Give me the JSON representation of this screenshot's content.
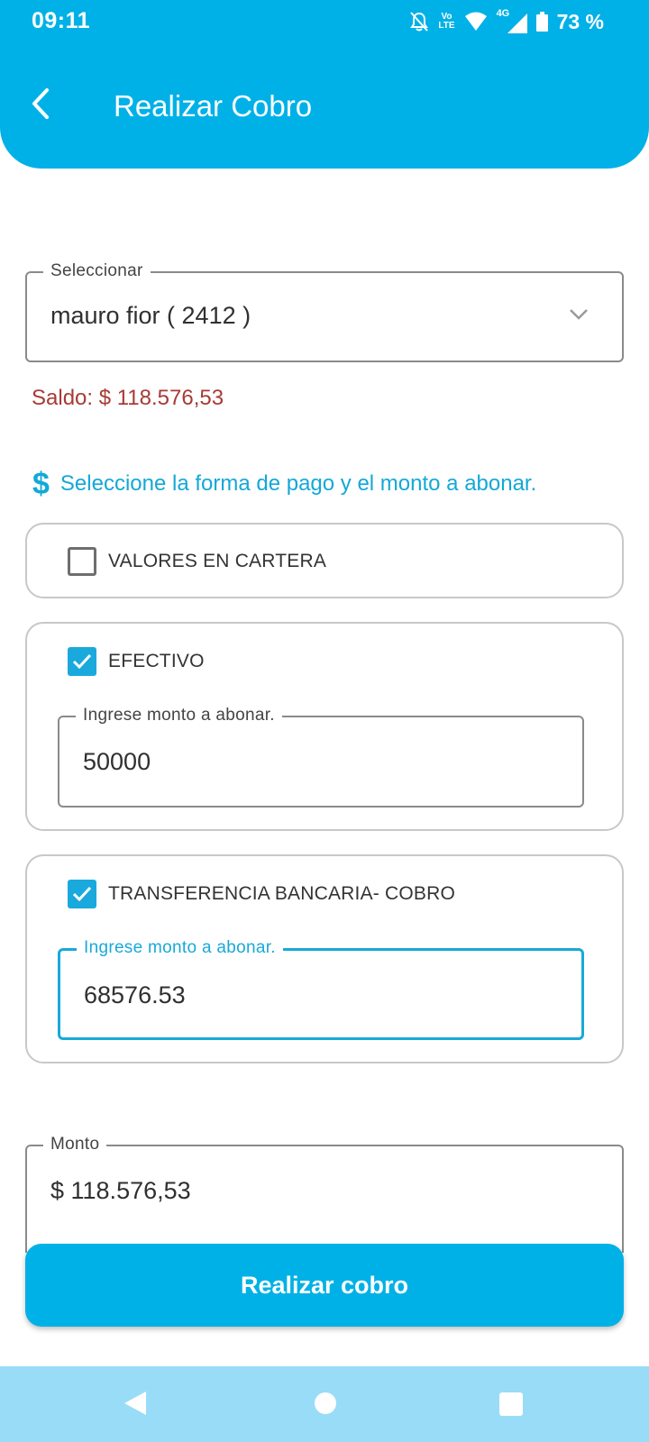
{
  "status_bar": {
    "time": "09:11",
    "network_top": "Vo",
    "network_bottom": "LTE",
    "signal_type": "4G",
    "battery": "73 %",
    "icons": [
      "bell-off-icon",
      "volte-icon",
      "wifi-icon",
      "signal-icon",
      "battery-icon"
    ]
  },
  "header": {
    "back_icon": "chevron-left-icon",
    "title": "Realizar Cobro",
    "color": "#00b1e7"
  },
  "client_select": {
    "label": "Seleccionar",
    "value": "mauro fior ( 2412 )",
    "icon": "chevron-down-icon"
  },
  "saldo": {
    "text": "Saldo: $ 118.576,53",
    "color": "#a83a36"
  },
  "instruction": {
    "icon": "dollar-icon",
    "icon_glyph": "$",
    "text": "Seleccione la forma de pago y el monto a abonar."
  },
  "payment_methods": [
    {
      "label": "VALORES EN CARTERA",
      "checked": false
    },
    {
      "label": "EFECTIVO",
      "checked": true,
      "amount_label": "Ingrese monto a abonar.",
      "amount_value": "50000"
    },
    {
      "label": "TRANSFERENCIA BANCARIA- COBRO",
      "checked": true,
      "amount_label": "Ingrese monto a abonar.",
      "amount_value": "68576.53",
      "focused": true
    }
  ],
  "monto": {
    "label": "Monto",
    "value": "$ 118.576,53"
  },
  "submit_button": {
    "label": "Realizar cobro"
  },
  "nav_bar": {
    "icons": [
      "back-triangle-icon",
      "home-circle-icon",
      "recents-square-icon"
    ]
  },
  "colors": {
    "accent": "#00b1e7",
    "checkbox": "#1aa9dc",
    "nav_bar": "#99dcf7"
  }
}
